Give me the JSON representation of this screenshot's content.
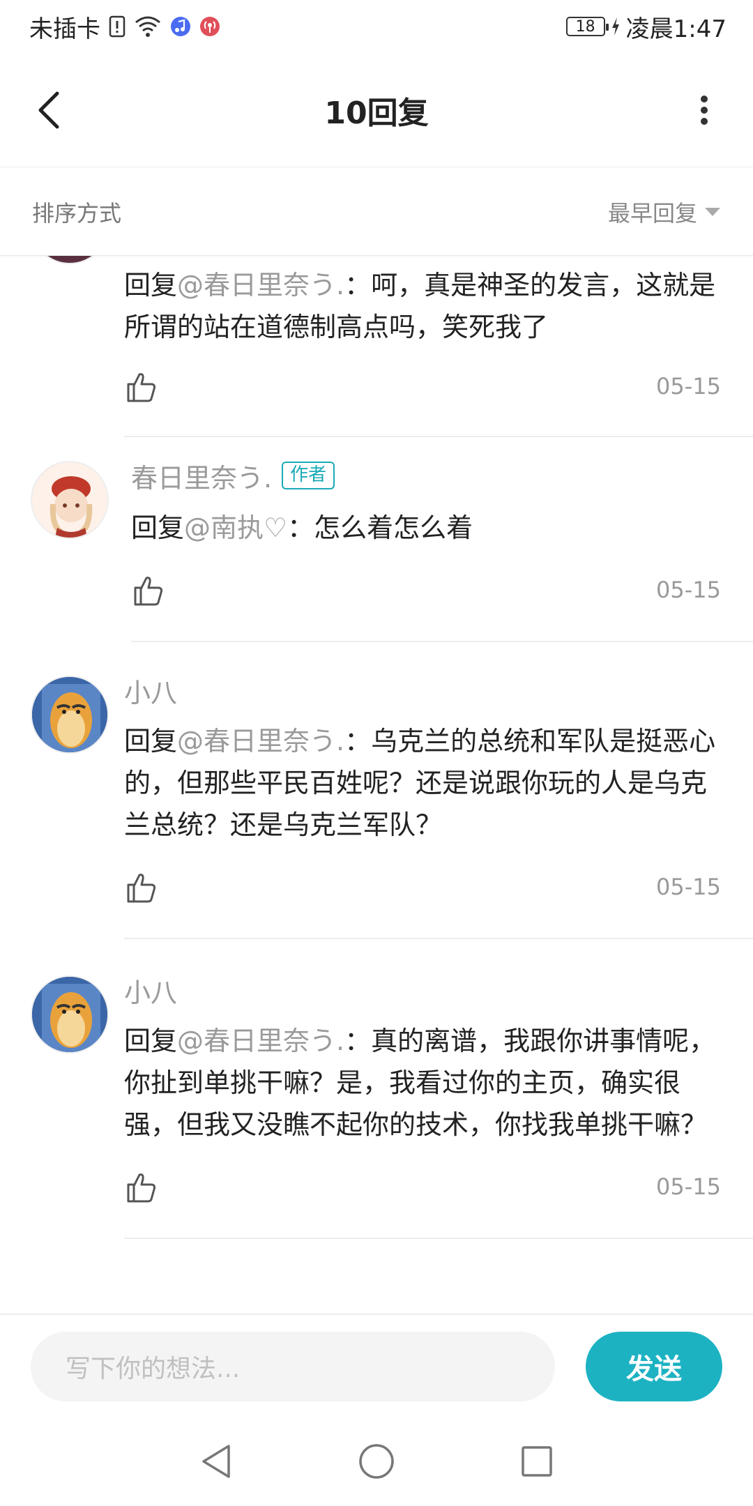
{
  "status_bar": {
    "carrier": "未插卡",
    "battery": "18",
    "time": "凌晨1:47"
  },
  "header": {
    "title": "10回复"
  },
  "sort": {
    "label": "排序方式",
    "value": "最早回复"
  },
  "comments": [
    {
      "username": "",
      "prefix": "回复",
      "mention": "@春日里奈う.",
      "text": "：呵，真是神圣的发言，这就是所谓的站在道德制高点吗，笑死我了",
      "date": "05-15"
    },
    {
      "username": "春日里奈う.",
      "badge": "作者",
      "prefix": "回复",
      "mention": "@南执♡",
      "text": "：怎么着怎么着",
      "date": "05-15"
    },
    {
      "username": "小八",
      "prefix": "回复",
      "mention": "@春日里奈う.",
      "text": "：乌克兰的总统和军队是挺恶心的，但那些平民百姓呢？还是说跟你玩的人是乌克兰总统？还是乌克兰军队？",
      "date": "05-15"
    },
    {
      "username": "小八",
      "prefix": "回复",
      "mention": "@春日里奈う.",
      "text": "：真的离谱，我跟你讲事情呢，你扯到单挑干嘛？是，我看过你的主页，确实很强，但我又没瞧不起你的技术，你找我单挑干嘛？",
      "date": "05-15"
    }
  ],
  "input": {
    "placeholder": "写下你的想法...",
    "send_label": "发送"
  },
  "colors": {
    "accent": "#1cb2c2",
    "muted_text": "#9a9a9a"
  }
}
